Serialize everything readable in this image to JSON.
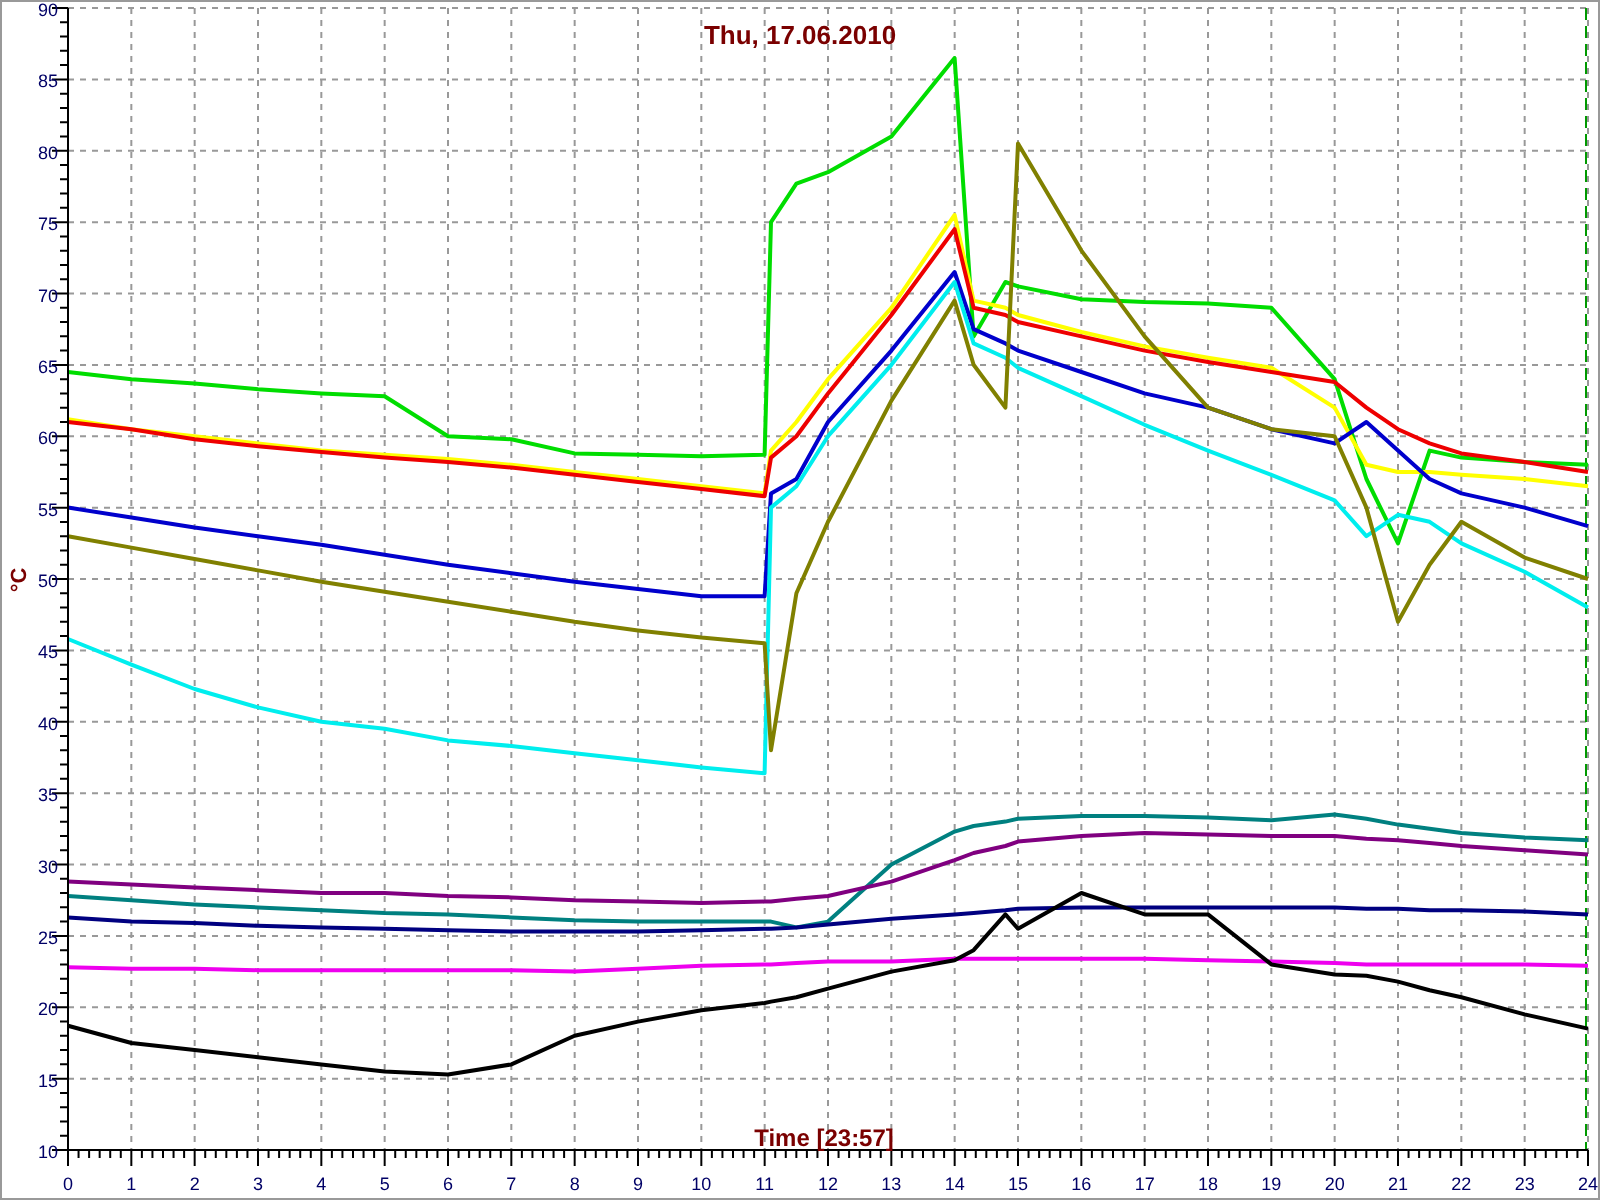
{
  "chart": {
    "chart_data": {
      "type": "line",
      "title": "Thu, 17.06.2010",
      "xlabel": "Time [23:57]",
      "ylabel": "°C",
      "x": [
        0,
        1,
        2,
        3,
        4,
        5,
        6,
        7,
        8,
        9,
        10,
        11,
        11.1,
        11.5,
        12,
        13,
        14,
        14.3,
        14.8,
        15,
        16,
        17,
        18,
        19,
        20,
        20.5,
        21,
        21.5,
        22,
        23,
        24
      ],
      "grid": true,
      "xlim": [
        0,
        24
      ],
      "ylim": [
        10,
        90
      ],
      "xticks": [
        0,
        1,
        2,
        3,
        4,
        5,
        6,
        7,
        8,
        9,
        10,
        11,
        12,
        13,
        14,
        15,
        16,
        17,
        18,
        19,
        20,
        21,
        22,
        23,
        24
      ],
      "yticks": [
        10,
        15,
        20,
        25,
        30,
        35,
        40,
        45,
        50,
        55,
        60,
        65,
        70,
        75,
        80,
        85,
        90
      ],
      "series": [
        {
          "color": "#00dd00",
          "values": [
            64.5,
            64,
            63.7,
            63.3,
            63,
            62.8,
            60,
            59.8,
            58.8,
            58.7,
            58.6,
            58.7,
            75,
            77.7,
            78.5,
            81,
            86.5,
            67,
            70.8,
            70.5,
            69.6,
            69.4,
            69.3,
            69,
            64,
            57,
            52.5,
            59,
            58.5,
            58.2,
            58
          ]
        },
        {
          "color": "#ffff00",
          "values": [
            61.2,
            60.5,
            60,
            59.5,
            59,
            58.7,
            58.4,
            58,
            57.5,
            57,
            56.5,
            56,
            59,
            61,
            64,
            69,
            75.5,
            69.5,
            69,
            68.5,
            67.3,
            66.3,
            65.5,
            64.8,
            62,
            58,
            57.5,
            57.5,
            57.3,
            57,
            56.5
          ]
        },
        {
          "color": "#ee0000",
          "values": [
            61,
            60.5,
            59.8,
            59.3,
            58.9,
            58.5,
            58.2,
            57.8,
            57.3,
            56.8,
            56.3,
            55.8,
            58.5,
            60,
            63,
            68.5,
            74.5,
            69,
            68.5,
            68,
            67,
            66,
            65.2,
            64.5,
            63.8,
            62,
            60.5,
            59.5,
            58.8,
            58.2,
            57.5
          ]
        },
        {
          "color": "#0000cc",
          "values": [
            55,
            54.3,
            53.6,
            53,
            52.4,
            51.7,
            51,
            50.4,
            49.8,
            49.3,
            48.8,
            48.8,
            56,
            57,
            61,
            66,
            71.5,
            67.5,
            66.5,
            66,
            64.5,
            63,
            62,
            60.5,
            59.5,
            61,
            59,
            57,
            56,
            55,
            53.7
          ]
        },
        {
          "color": "#00eeee",
          "values": [
            45.8,
            44,
            42.3,
            41,
            40,
            39.5,
            38.7,
            38.3,
            37.8,
            37.3,
            36.8,
            36.4,
            55,
            56.5,
            60,
            65,
            70.8,
            66.5,
            65.5,
            64.8,
            62.8,
            60.8,
            59,
            57.3,
            55.5,
            53,
            54.5,
            54,
            52.5,
            50.5,
            48
          ]
        },
        {
          "color": "#808000",
          "values": [
            53,
            52.2,
            51.4,
            50.6,
            49.8,
            49.1,
            48.4,
            47.7,
            47,
            46.4,
            45.9,
            45.5,
            38,
            49,
            54,
            62.5,
            69.5,
            65,
            62,
            80.5,
            73,
            67,
            62,
            60.5,
            60,
            55,
            47,
            51,
            54,
            51.5,
            50
          ]
        },
        {
          "color": "#008080",
          "values": [
            27.8,
            27.5,
            27.2,
            27,
            26.8,
            26.6,
            26.5,
            26.3,
            26.1,
            26,
            26,
            26,
            26,
            25.6,
            26,
            30,
            32.3,
            32.7,
            33,
            33.2,
            33.4,
            33.4,
            33.3,
            33.1,
            33.5,
            33.2,
            32.8,
            32.5,
            32.2,
            31.9,
            31.7
          ]
        },
        {
          "color": "#800080",
          "values": [
            28.8,
            28.6,
            28.4,
            28.2,
            28,
            28,
            27.8,
            27.7,
            27.5,
            27.4,
            27.3,
            27.4,
            27.4,
            27.6,
            27.8,
            28.8,
            30.3,
            30.8,
            31.3,
            31.6,
            32,
            32.2,
            32.1,
            32,
            32,
            31.8,
            31.7,
            31.5,
            31.3,
            31,
            30.7
          ]
        },
        {
          "color": "#000080",
          "values": [
            26.3,
            26,
            25.9,
            25.7,
            25.6,
            25.5,
            25.4,
            25.3,
            25.3,
            25.3,
            25.4,
            25.5,
            25.5,
            25.6,
            25.8,
            26.2,
            26.5,
            26.6,
            26.8,
            26.9,
            27,
            27,
            27,
            27,
            27,
            26.9,
            26.9,
            26.8,
            26.8,
            26.7,
            26.5
          ]
        },
        {
          "color": "#ee00ee",
          "values": [
            22.8,
            22.7,
            22.7,
            22.6,
            22.6,
            22.6,
            22.6,
            22.6,
            22.5,
            22.7,
            22.9,
            23,
            23,
            23.1,
            23.2,
            23.2,
            23.4,
            23.4,
            23.4,
            23.4,
            23.4,
            23.4,
            23.3,
            23.2,
            23.1,
            23,
            23,
            23,
            23,
            23,
            22.9
          ]
        },
        {
          "color": "#000000",
          "values": [
            18.7,
            17.5,
            17,
            16.5,
            16,
            15.5,
            15.3,
            16,
            18,
            19,
            19.8,
            20.3,
            20.4,
            20.7,
            21.3,
            22.5,
            23.3,
            24,
            26.5,
            25.5,
            28,
            26.5,
            26.5,
            23,
            22.3,
            22.2,
            21.8,
            21.2,
            20.7,
            19.5,
            18.5
          ]
        }
      ]
    }
  }
}
